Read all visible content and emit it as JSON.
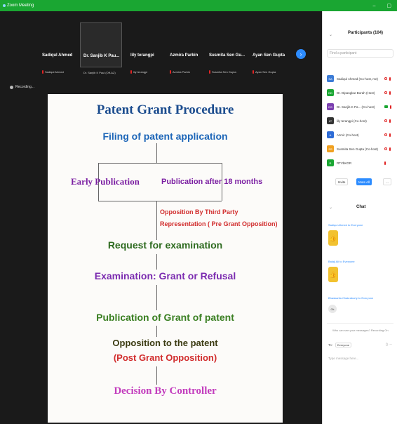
{
  "window": {
    "title": "Zoom Meeting",
    "minimize": "–",
    "maximize": "▢"
  },
  "thumbnails": [
    {
      "name": "Sadiqul Ahmed",
      "sub": "Sadiqul Ahmed"
    },
    {
      "name": "Dr. Sanjib K Pau...",
      "sub": "Dr. Sanjib K Paul (Off-AZ)"
    },
    {
      "name": "lily terangpi",
      "sub": "lily terangpi"
    },
    {
      "name": "Azmira Parbin",
      "sub": "Azmira Parbin"
    },
    {
      "name": "Susmita Sen Gu...",
      "sub": "Susmita Sen Gupta"
    },
    {
      "name": "Ayan Sen Gupta",
      "sub": "Ayan Sen Gupta"
    }
  ],
  "recording_label": "Recording...",
  "slide": {
    "title": "Patent Grant Procedure",
    "filing": "Filing of patent application",
    "early": "Early Publication",
    "after": "Publication after 18 months",
    "opp_third_1": "Opposition By Third Party",
    "opp_third_2": "Representation  ( Pre Grant Opposition)",
    "request": "Request for examination",
    "exam": "Examination: Grant or Refusal",
    "publication": "Publication of Grant of patent",
    "opp_patent": "Opposition to the patent",
    "post_grant": "(Post Grant Opposition)",
    "decision": "Decision By Controller"
  },
  "participants": {
    "header": "Participants (104)",
    "search_placeholder": "Find a participant",
    "list": [
      {
        "initials": "SA",
        "name": "Sadiqul Ahmed (Co-host, me)",
        "color": "#3b7bd6"
      },
      {
        "initials": "DD",
        "name": "Dr. Dipangkar Borah (Host)",
        "color": "#1aa632"
      },
      {
        "initials": "DS",
        "name": "Dr. Sanjib K Pa... (Co-host)",
        "color": "#7b3fb0"
      },
      {
        "initials": "LT",
        "name": "lily terangpi (Co-host)",
        "color": "#333333"
      },
      {
        "initials": "A",
        "name": "Azmir (Co-host)",
        "color": "#2d6bd6"
      },
      {
        "initials": "SS",
        "name": "Susmita Sen Gupta (Co-host)",
        "color": "#f0a020"
      },
      {
        "initials": "R",
        "name": "RTVbKGR",
        "color": "#1aa632"
      }
    ],
    "invite": "Invite",
    "mute_all": "Mute All",
    "more": "..."
  },
  "chat": {
    "header": "Chat",
    "meta1": "Sadiqul Ahmed to Everyone",
    "meta2": "Balaji Ali to Everyone",
    "meta3": "Bhaskarita Chakraborty to Everyone",
    "ok": "Ok",
    "notice": "Who can see your messages? Recording On",
    "to": "To:",
    "to_value": "Everyone",
    "tools": "▯ ⋯",
    "placeholder": "Type message here..."
  }
}
